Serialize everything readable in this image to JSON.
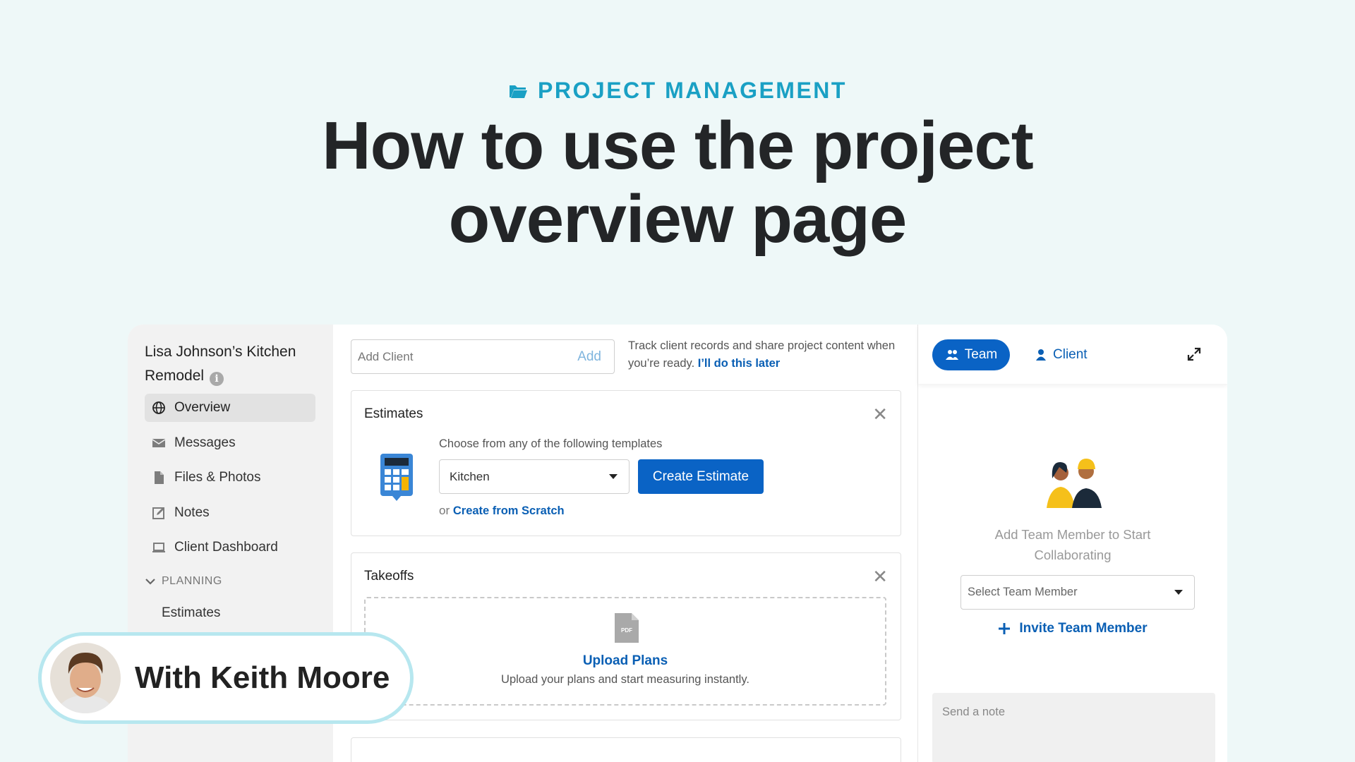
{
  "hero": {
    "eyebrow": "PROJECT MANAGEMENT",
    "title_line1": "How to use the project",
    "title_line2": "overview page",
    "accent": "#1aa0c4"
  },
  "sidebar": {
    "project_title": "Lisa Johnson’s Kitchen Remodel",
    "items": [
      {
        "label": "Overview",
        "icon": "globe-icon",
        "active": true
      },
      {
        "label": "Messages",
        "icon": "envelope-icon"
      },
      {
        "label": "Files & Photos",
        "icon": "file-icon"
      },
      {
        "label": "Notes",
        "icon": "note-edit-icon"
      },
      {
        "label": "Client Dashboard",
        "icon": "laptop-icon"
      }
    ],
    "section": "PLANNING",
    "sub_items": [
      {
        "label": "Estimates"
      }
    ]
  },
  "main": {
    "add_client": {
      "placeholder": "Add Client",
      "button": "Add"
    },
    "track_text": "Track client records and share project content when you’re ready.",
    "track_link": "I’ll do this later",
    "estimates": {
      "title": "Estimates",
      "templates_label": "Choose from any of the following templates",
      "selected_template": "Kitchen",
      "create_button": "Create Estimate",
      "or_text": "or",
      "scratch_link": "Create from Scratch"
    },
    "takeoffs": {
      "title": "Takeoffs",
      "upload_title": "Upload Plans",
      "upload_sub": "Upload your plans and start measuring instantly."
    }
  },
  "right_panel": {
    "tabs": {
      "team": "Team",
      "client": "Client"
    },
    "message": "Add Team Member to Start Collaborating",
    "select_placeholder": "Select Team Member",
    "invite": "Invite Team Member",
    "note_placeholder": "Send a note"
  },
  "presenter": {
    "name": "With Keith Moore"
  },
  "colors": {
    "brand_blue": "#0a63c5",
    "link_blue": "#0a5fb4",
    "background": "#eef8f8"
  }
}
